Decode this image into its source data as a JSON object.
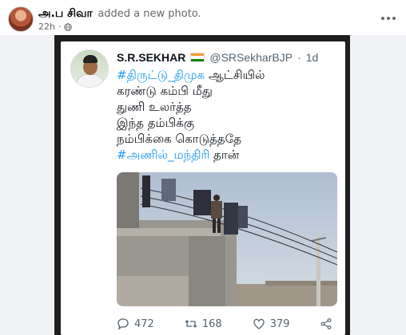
{
  "post": {
    "author": "அ.ப சிவா",
    "action": "added a new photo.",
    "time": "22h"
  },
  "tweet": {
    "name": "S.R.SEKHAR",
    "handle": "@SRSekharBJP",
    "separator": "·",
    "time": "1d",
    "lines": [
      {
        "hashtag": "#திருட்டு_திமுக",
        "text": " ஆட்சியில்"
      },
      {
        "text": "கரண்டு கம்பி மீது"
      },
      {
        "text": "துணி உலர்த்த"
      },
      {
        "text": "இந்த தம்பிக்கு"
      },
      {
        "text": "நம்பிக்கை கொடுத்ததே"
      },
      {
        "hashtag": "#அணில்_மந்திரி",
        "text": " தான்"
      }
    ],
    "replies": "472",
    "retweets": "168",
    "likes": "379"
  },
  "icons": {
    "globe": "globe-icon",
    "more": "more-options-icon",
    "flag": "india-flag-icon",
    "reply": "reply-icon",
    "retweet": "retweet-icon",
    "like": "heart-icon",
    "share": "share-icon"
  },
  "colors": {
    "hashtag": "#1d9bf0",
    "frame": "#1f1f1f",
    "flag_saffron": "#ff9933",
    "flag_green": "#138808"
  }
}
